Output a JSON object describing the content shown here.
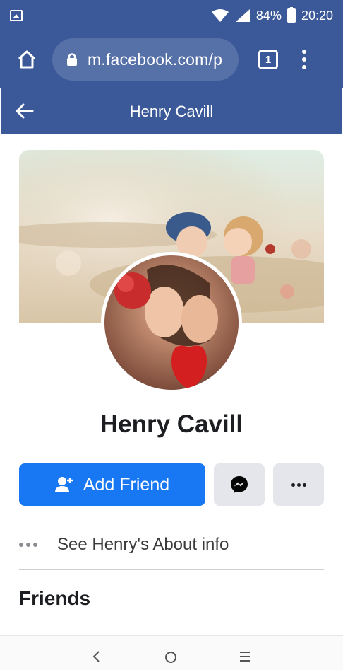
{
  "status_bar": {
    "battery": "84%",
    "time": "20:20",
    "icons": [
      "image-icon",
      "wifi-icon",
      "signal-icon",
      "battery-charging-icon"
    ]
  },
  "browser": {
    "url": "m.facebook.com/p",
    "tab_count": "1",
    "icons": [
      "home-icon",
      "lock-icon",
      "more-vertical-icon"
    ]
  },
  "header": {
    "title": "Henry Cavill",
    "back_icon": "arrow-left-icon"
  },
  "profile": {
    "name": "Henry Cavill",
    "add_friend_label": "Add Friend",
    "about_label": "See Henry's About info",
    "friends_title": "Friends"
  },
  "colors": {
    "facebook_blue": "#3b5998",
    "button_blue": "#1877f2",
    "secondary_button": "#e4e6eb"
  },
  "nav": {
    "icons": [
      "back-icon",
      "home-circle-icon",
      "recents-icon"
    ]
  }
}
